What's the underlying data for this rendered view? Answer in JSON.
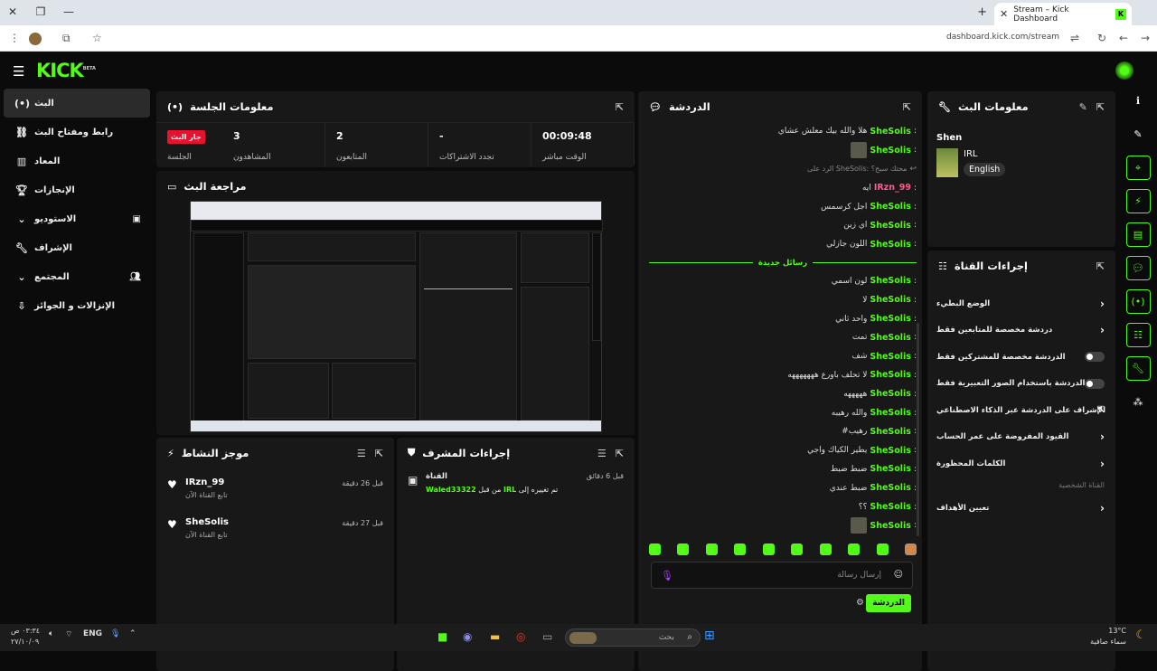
{
  "browser": {
    "tab_title": "Stream – Kick Dashboard",
    "url": "dashboard.kick.com/stream"
  },
  "app": {
    "logo": "KICK",
    "logo_sup": "BETA"
  },
  "nav": {
    "items": [
      {
        "label": "البث",
        "icon": "live-icon"
      },
      {
        "label": "رابط ومفتاح البث",
        "icon": "link-icon"
      },
      {
        "label": "المعاد",
        "icon": "stats-icon"
      },
      {
        "label": "الإنجازات",
        "icon": "trophy-icon"
      },
      {
        "label": "الاستوديو",
        "icon": "studio-icon"
      },
      {
        "label": "الإشراف",
        "icon": "wrench-icon"
      },
      {
        "label": "المجتمع",
        "icon": "community-icon"
      },
      {
        "label": "الإنزالات و الجوائز",
        "icon": "drops-icon"
      }
    ]
  },
  "session": {
    "title": "معلومات الجلسة",
    "stats": [
      {
        "value": "00:09:48",
        "label": "الوقت مباشر"
      },
      {
        "value": "-",
        "label": "تجدد الاشتراكات"
      },
      {
        "value": "2",
        "label": "المتابعون"
      },
      {
        "value": "3",
        "label": "المشاهدون"
      },
      {
        "value": "جار البث",
        "label": "الجلسة"
      }
    ]
  },
  "preview": {
    "title": "مراجعة البث"
  },
  "activity": {
    "title": "موجز النشاط",
    "items": [
      {
        "name": "IRzn_99",
        "sub": "تابع القناة الآن",
        "time": "قبل 26 دقيقة"
      },
      {
        "name": "SheSolis",
        "sub": "تابع القناة الآن",
        "time": "قبل 27 دقيقة"
      }
    ]
  },
  "modactions": {
    "title": "إجراءات المشرف",
    "item_title": "القناة",
    "item_text_pre": "من قبل",
    "item_user": "Waled33322",
    "item_text_mid": "تم تغييره إلى",
    "item_cat": "IRL",
    "item_time": "قبل 6 دقائق"
  },
  "chat": {
    "title": "الدردشة",
    "messages": [
      {
        "user": "SheSolis",
        "text": "هلا والله بيك معلش عشاي"
      },
      {
        "user": "SheSolis",
        "text": "",
        "emote": true
      },
      {
        "reply": "الرد على SheSolis: محتك سبح؟"
      },
      {
        "user": "IRzn_99",
        "text": "ايه",
        "pink": true
      },
      {
        "user": "SheSolis",
        "text": "اجل كرسمس"
      },
      {
        "user": "SheSolis",
        "text": "اي زين"
      },
      {
        "user": "SheSolis",
        "text": "اللون جازلي"
      },
      {
        "divider": "رسائل جديدة"
      },
      {
        "user": "SheSolis",
        "text": "لون اسمي"
      },
      {
        "user": "SheSolis",
        "text": "لا"
      },
      {
        "user": "SheSolis",
        "text": "واحد ثاني"
      },
      {
        "user": "SheSolis",
        "text": "تمت"
      },
      {
        "user": "SheSolis",
        "text": "شف"
      },
      {
        "user": "SheSolis",
        "text": "لا تحلف باورع هههههههه"
      },
      {
        "user": "SheSolis",
        "text": "هههههه"
      },
      {
        "user": "SheSolis",
        "text": "والله رهيبه"
      },
      {
        "user": "SheSolis",
        "text": "#رهيب"
      },
      {
        "user": "SheSolis",
        "text": "يطير الكياك واجي"
      },
      {
        "user": "SheSolis",
        "text": "ضبط ضبط"
      },
      {
        "user": "SheSolis",
        "text": "ضبط عندي"
      },
      {
        "user": "SheSolis",
        "text": "؟؟"
      },
      {
        "user": "SheSolis",
        "text": "",
        "emote": true
      },
      {
        "user": "SheSolis",
        "text": "",
        "emote": true
      }
    ],
    "placeholder": "إرسال رسالة",
    "send": "الدردشة",
    "accent": "#53fc18"
  },
  "streaminfo": {
    "title": "معلومات البث",
    "name": "Shen",
    "category": "IRL",
    "language": "English"
  },
  "channel": {
    "title": "إجراءات القناة",
    "rows": [
      {
        "label": "الوضع البطيء",
        "kind": "chevron"
      },
      {
        "label": "دردشة مخصصة للمتابعين فقط",
        "kind": "chevron"
      },
      {
        "label": "الدردشة مخصصة للمشتركين فقط",
        "kind": "toggle"
      },
      {
        "label": "الدردشة باستخدام الصور التعبيرية فقط",
        "kind": "toggle"
      },
      {
        "label": "الإشراف على الدردشة عبر الذكاء الاصطناعي",
        "kind": "external"
      },
      {
        "label": "القيود المفروضة على عمر الحساب",
        "kind": "chevron"
      },
      {
        "label": "الكلمات المحظورة",
        "kind": "chevron"
      }
    ],
    "section": "القناة الشخصية",
    "goal_label": "تعيين الأهداف"
  },
  "taskbar": {
    "search_placeholder": "بحث",
    "lang": "ENG",
    "time": "٠٣:٣٤ ص",
    "date": "٢٧/١٠/٠٩",
    "weather_temp": "13°C",
    "weather_desc": "سماء صافية"
  }
}
